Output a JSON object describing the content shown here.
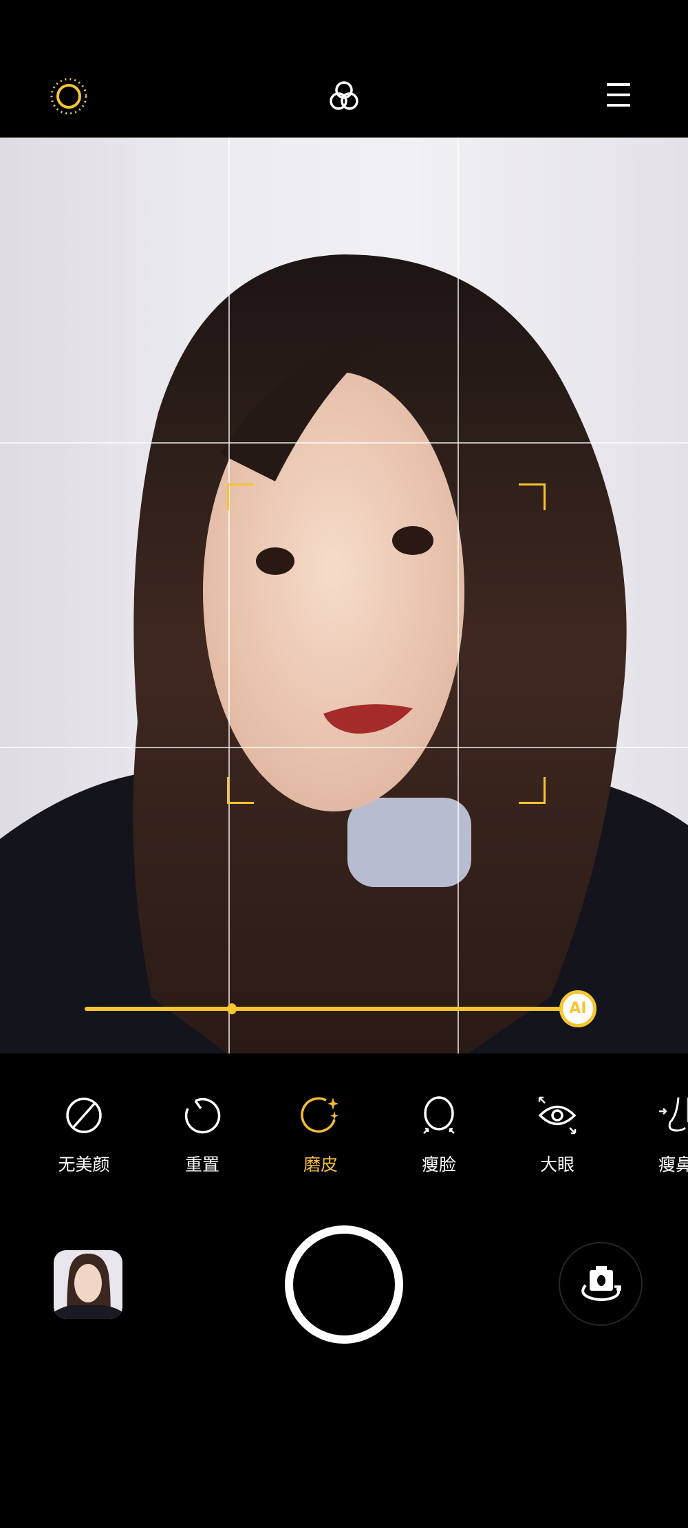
{
  "top_bar": {
    "icons": [
      "beauty-light-icon",
      "filter-icon",
      "menu-icon"
    ],
    "accent_color": "#f7c531"
  },
  "preview": {
    "grid": "3x3",
    "face_frame_color": "#f7c531",
    "slider": {
      "level_percent": 100,
      "default_marker_percent": 30,
      "knob_label": "AI",
      "color": "#f7c531"
    }
  },
  "beauty_tools": {
    "items": [
      {
        "label": "无美颜",
        "icon": "no-beauty-icon",
        "active": false
      },
      {
        "label": "重置",
        "icon": "reset-icon",
        "active": false
      },
      {
        "label": "磨皮",
        "icon": "smooth-skin-icon",
        "active": true
      },
      {
        "label": "瘦脸",
        "icon": "slim-face-icon",
        "active": false
      },
      {
        "label": "大眼",
        "icon": "big-eyes-icon",
        "active": false
      },
      {
        "label": "瘦鼻",
        "icon": "slim-nose-icon",
        "active": false
      }
    ],
    "active_color": "#f2bd3a"
  },
  "bottom_bar": {
    "icons": [
      "gallery-thumbnail",
      "shutter-button",
      "switch-camera-icon"
    ]
  }
}
